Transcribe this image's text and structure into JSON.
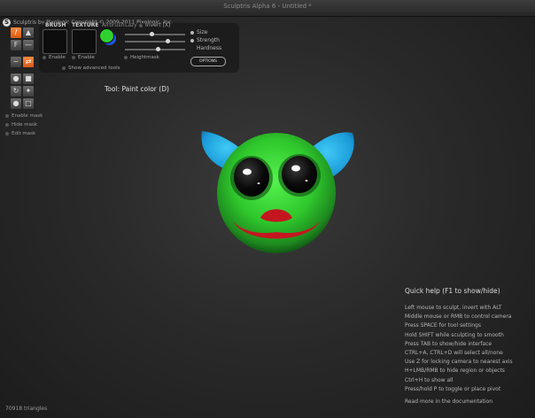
{
  "window": {
    "title": "Sculptris Alpha 6 - Untitled *"
  },
  "app": {
    "title": "Sculptris by Pixologic    Copyright © 2009-2011 Pixologic, Inc."
  },
  "tools": [
    {
      "icon": "brush-stroke-icon",
      "glyph": "/"
    },
    {
      "icon": "sculpt-bump-icon",
      "glyph": "▲"
    },
    {
      "icon": "flatten-icon",
      "glyph": "F"
    },
    {
      "icon": "crease-icon",
      "glyph": "—"
    },
    {
      "icon": "smooth-icon",
      "glyph": "~"
    },
    {
      "icon": "paint-swap-icon",
      "glyph": "⇄"
    },
    {
      "icon": "pinch-icon",
      "glyph": "●"
    },
    {
      "icon": "scale-icon",
      "glyph": "■"
    },
    {
      "icon": "rotate-icon",
      "glyph": "↻"
    },
    {
      "icon": "grab-icon",
      "glyph": "✦"
    },
    {
      "icon": "draw-icon",
      "glyph": "●"
    },
    {
      "icon": "mask-icon",
      "glyph": "□"
    }
  ],
  "mask": {
    "enable": "Enable mask",
    "hide": "Hide mask",
    "edit": "Edit mask"
  },
  "panel": {
    "brush_label": "BRUSH",
    "texture_label": "TEXTURE",
    "airbrush_label": "Airbrush",
    "lazy_label": "Lazy",
    "invert_label": "Invert [X]",
    "brush_enable": "Enable",
    "texture_enable": "Enable",
    "heightmask": "Heightmask",
    "show_advanced": "Show advanced tools",
    "sliders": [
      {
        "name": "Size",
        "value": 0.45
      },
      {
        "name": "Strength",
        "value": 0.72
      },
      {
        "name": "Hardness",
        "value": 0.55
      }
    ],
    "options_label": "OPTIONS",
    "colors": {
      "primary": "#2fd12f",
      "secondary": "#2157e6"
    }
  },
  "tool_caption": "Tool: Paint color (D)",
  "quickhelp": {
    "title": "Quick help (F1 to show/hide)",
    "lines": [
      "Left mouse to sculpt, invert with ALT",
      "Middle mouse or RMB to control camera",
      "Press SPACE for tool settings",
      "Hold SHIFT while sculpting to smooth",
      "Press TAB to show/hide interface",
      "CTRL+A, CTRL+D will select all/none",
      "Use Z for locking camera to nearest axis",
      "H+LMB/RMB to hide region or objects",
      "Ctrl+H to show all",
      "Press/hold P to toggle or place pivot"
    ],
    "doc_link": "Read more in the documentation"
  },
  "status": {
    "triangles": "70918 triangles"
  },
  "colors": {
    "accent": "#e8742a",
    "model_green": "#2fd12f",
    "model_blue": "#1aa5e0",
    "model_red": "#c4161f"
  }
}
